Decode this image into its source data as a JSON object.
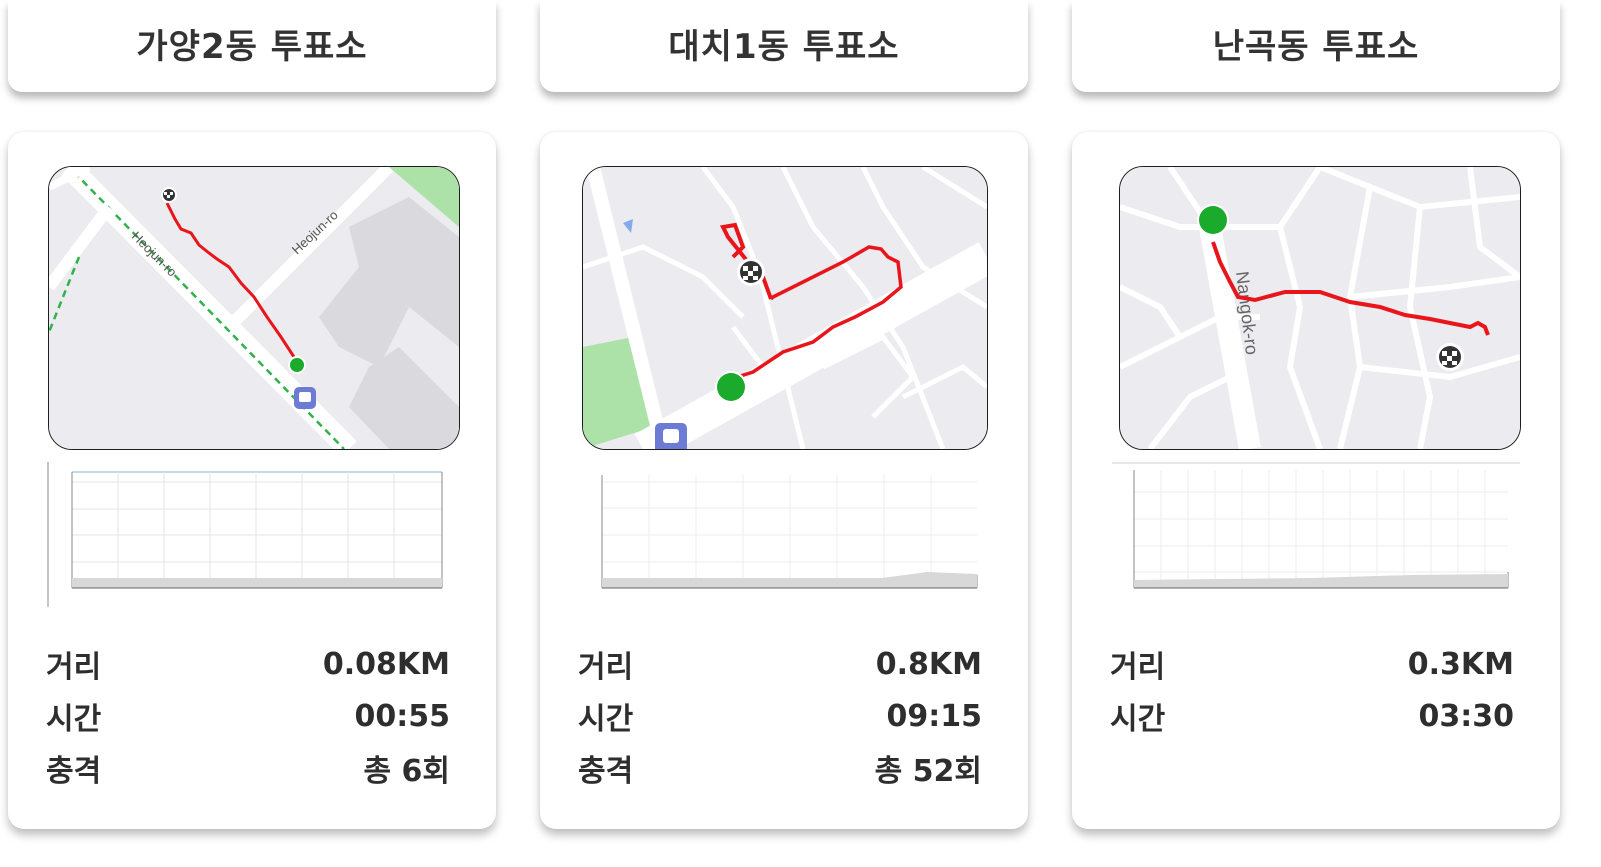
{
  "cards": [
    {
      "title": "가양2동 투표소",
      "map": {
        "road_labels": [
          "Heojun-ro",
          "Heojun-ro"
        ]
      },
      "stats": [
        {
          "label": "거리",
          "value": "0.08KM"
        },
        {
          "label": "시간",
          "value": "00:55"
        },
        {
          "label": "충격",
          "value": "총 6회"
        }
      ]
    },
    {
      "title": "대치1동 투표소",
      "map": {
        "road_labels": []
      },
      "stats": [
        {
          "label": "거리",
          "value": "0.8KM"
        },
        {
          "label": "시간",
          "value": "09:15"
        },
        {
          "label": "충격",
          "value": "총 52회"
        }
      ]
    },
    {
      "title": "난곡동 투표소",
      "map": {
        "road_labels": [
          "Nangok-ro"
        ]
      },
      "stats": [
        {
          "label": "거리",
          "value": "0.3KM"
        },
        {
          "label": "시간",
          "value": "03:30"
        }
      ]
    }
  ],
  "colors": {
    "route": "#e8161b",
    "start_marker": "#1bab2c",
    "park": "#ace2a8",
    "road": "#ffffff",
    "map_bg": "#ebebf0",
    "bus_stop": "#6c7bd4"
  },
  "icons": [
    "finish-flag-icon",
    "start-marker-icon",
    "bus-stop-icon",
    "location-arrow-icon"
  ]
}
